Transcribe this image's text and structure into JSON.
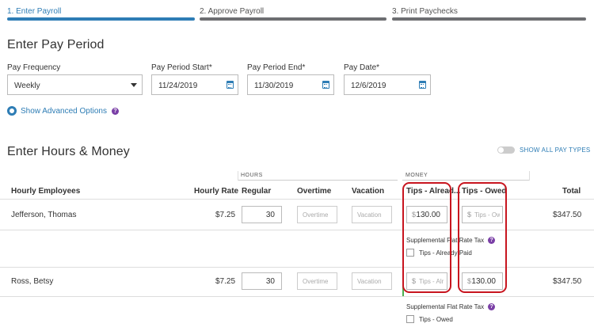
{
  "steps": [
    {
      "label": "1. Enter Payroll",
      "active": true
    },
    {
      "label": "2. Approve Payroll",
      "active": false
    },
    {
      "label": "3. Print Paychecks",
      "active": false
    }
  ],
  "pay_period": {
    "title": "Enter Pay Period",
    "frequency_label": "Pay Frequency",
    "frequency_value": "Weekly",
    "start_label": "Pay Period Start*",
    "start_value": "11/24/2019",
    "end_label": "Pay Period End*",
    "end_value": "11/30/2019",
    "pay_date_label": "Pay Date*",
    "pay_date_value": "12/6/2019",
    "advanced_label": "Show Advanced Options",
    "help_glyph": "?"
  },
  "hours_money": {
    "title": "Enter Hours & Money",
    "toggle_label": "SHOW ALL PAY TYPES",
    "group_hours": "HOURS",
    "group_money": "MONEY",
    "columns": {
      "employee": "Hourly Employees",
      "rate": "Hourly Rate",
      "regular": "Regular",
      "overtime": "Overtime",
      "vacation": "Vacation",
      "tips_already": "Tips - Alread...",
      "tips_owed": "Tips - Owed",
      "total": "Total"
    },
    "currency_symbol": "$",
    "rows": [
      {
        "name": "Jefferson, Thomas",
        "rate": "$7.25",
        "regular": "30",
        "overtime_placeholder": "Overtime",
        "vacation_placeholder": "Vacation",
        "tips_already_value": "130.00",
        "tips_owed_placeholder": "Tips - Ow",
        "total": "$347.50",
        "supp_label": "Supplemental Flat Rate Tax",
        "supp_option": "Tips - Already Paid"
      },
      {
        "name": "Ross, Betsy",
        "rate": "$7.25",
        "regular": "30",
        "overtime_placeholder": "Overtime",
        "vacation_placeholder": "Vacation",
        "tips_already_placeholder": "Tips - Alr",
        "tips_owed_value": "130.00",
        "total": "$347.50",
        "supp_label": "Supplemental Flat Rate Tax",
        "supp_option": "Tips - Owed"
      }
    ]
  },
  "colors": {
    "accent": "#2e7db5",
    "annotation": "#c8151f",
    "help": "#7a3fa6",
    "divider_green": "#4caf50"
  }
}
